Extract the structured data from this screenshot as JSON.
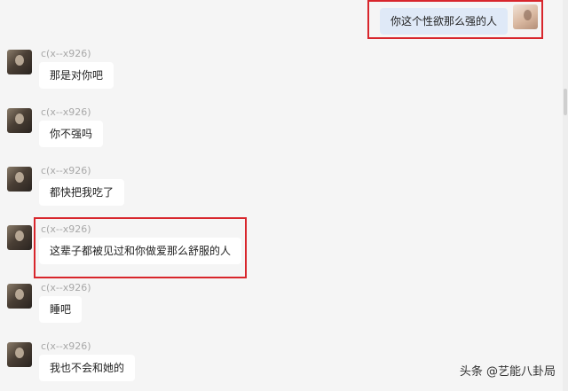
{
  "self_message": {
    "text": "你这个性欲那么强的人"
  },
  "messages": [
    {
      "sender": "c(x--x926)",
      "text": "那是对你吧"
    },
    {
      "sender": "c(x--x926)",
      "text": "你不强吗"
    },
    {
      "sender": "c(x--x926)",
      "text": "都快把我吃了"
    },
    {
      "sender": "c(x--x926)",
      "text": "这辈子都被见过和你做爱那么舒服的人"
    },
    {
      "sender": "c(x--x926)",
      "text": "睡吧"
    },
    {
      "sender": "c(x--x926)",
      "text": "我也不会和她的"
    }
  ],
  "watermark": "头条 @艺能八卦局",
  "colors": {
    "highlight": "#d8262c",
    "self_bubble": "#dfe9f7",
    "background": "#f5f5f5"
  }
}
